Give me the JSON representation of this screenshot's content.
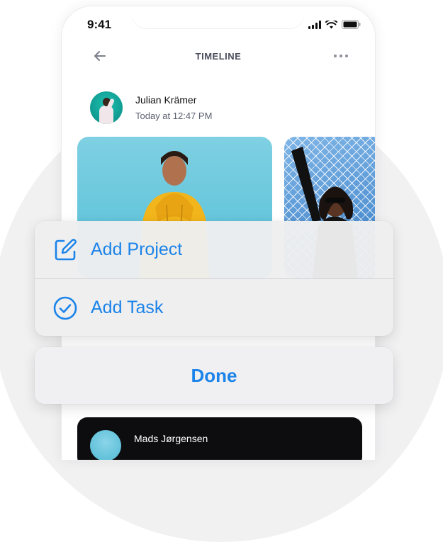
{
  "status_bar": {
    "time": "9:41"
  },
  "nav": {
    "title": "TIMELINE",
    "back_icon": "arrow-left-icon",
    "more_icon": "more-horizontal-icon"
  },
  "post": {
    "author": "Julian Krämer",
    "timestamp": "Today at 12:47 PM"
  },
  "next_post": {
    "author": "Mads Jørgensen"
  },
  "action_sheet": {
    "items": [
      {
        "label": "Add Project",
        "icon": "edit-square-icon"
      },
      {
        "label": "Add Task",
        "icon": "check-circle-icon"
      }
    ],
    "done_label": "Done"
  },
  "colors": {
    "accent": "#1b83e9",
    "sheet_background": "#eeeef0",
    "avatar_teal": "#0f9a90"
  }
}
